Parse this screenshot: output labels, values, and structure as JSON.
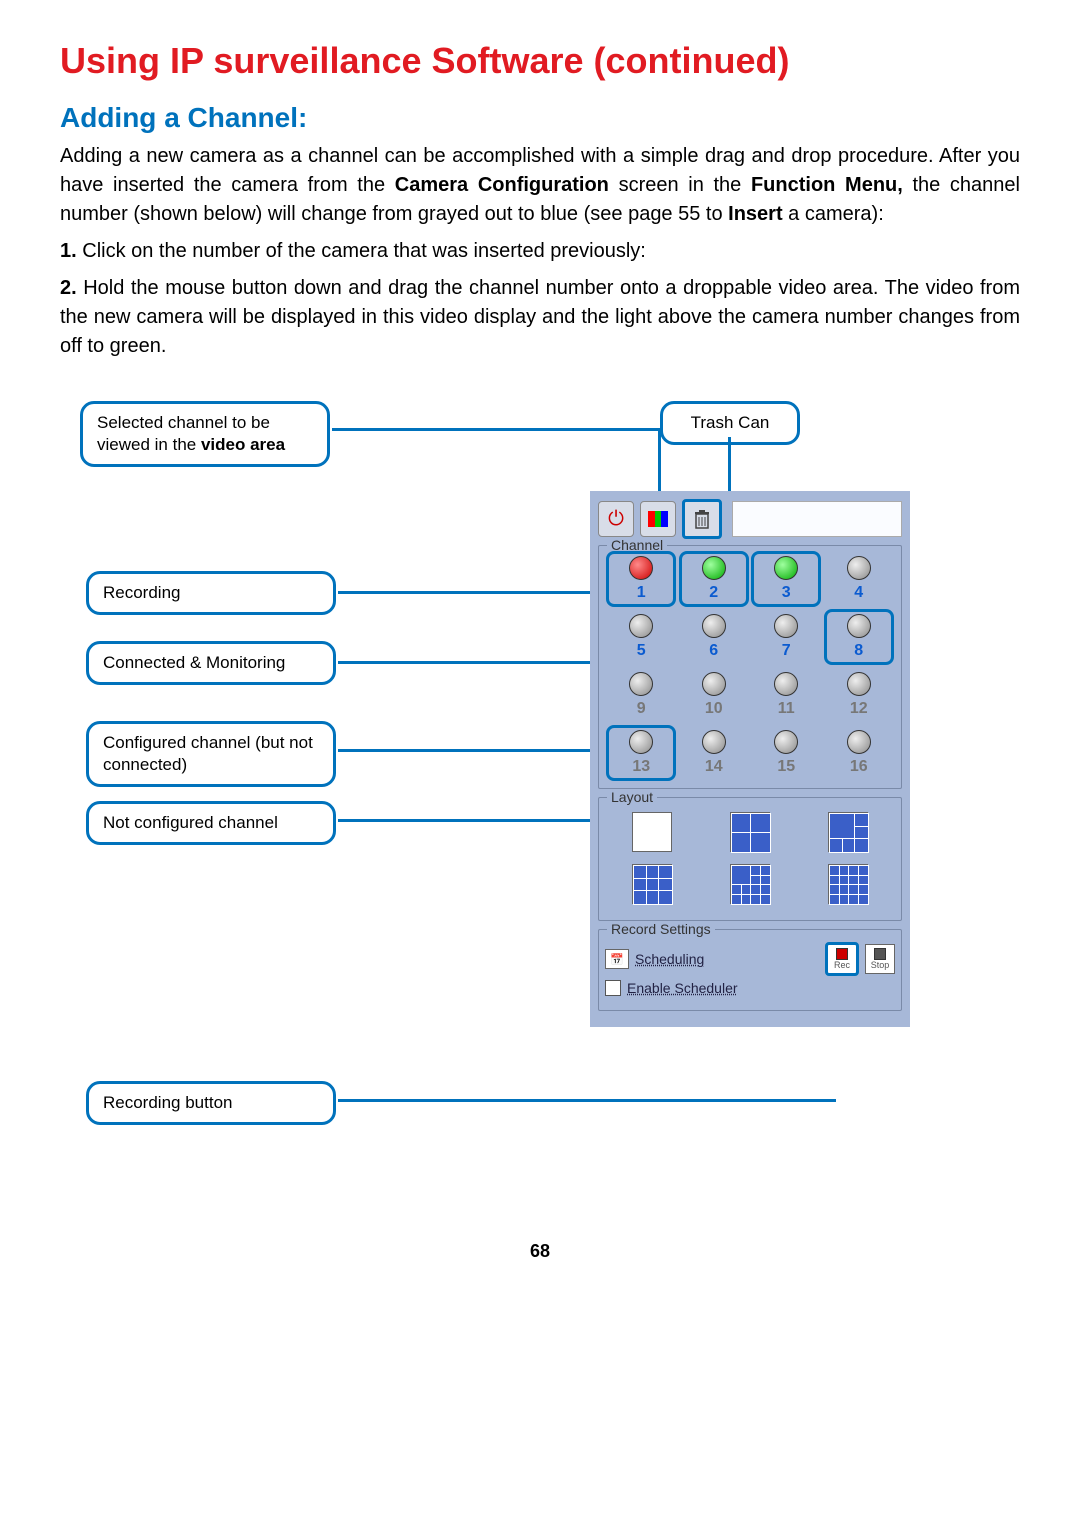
{
  "title": "Using IP surveillance Software (continued)",
  "subtitle": "Adding a Channel:",
  "intro_html": "Adding a new camera as a channel can be accomplished with a simple drag and drop procedure.  After you have inserted the camera from the <b>Camera Configuration</b> screen in the <b>Function Menu,</b> the channel number (shown below) will change from grayed out to blue (see page 55 to <b>Insert</b> a camera):",
  "step1": "1.  Click on the number of the camera that was inserted previously:",
  "step2": "2.  Hold the mouse button down and drag the channel number onto a droppable video area.  The video from the new camera will be displayed in this video display and the light above the camera number changes from off to green.",
  "callouts": {
    "selected": "Selected channel to be viewed in the <b>video area</b>",
    "trash": "Trash Can",
    "recording": "Recording",
    "connected": "Connected & Monitoring",
    "configured": "Configured channel (but not connected)",
    "notconfigured": "Not configured channel",
    "recbutton": "Recording button"
  },
  "panel": {
    "channel_label": "Channel",
    "layout_label": "Layout",
    "record_label": "Record Settings",
    "scheduling": "Scheduling",
    "enable_scheduler": "Enable Scheduler",
    "rec": "Rec",
    "stop": "Stop"
  },
  "channels": [
    {
      "n": "1",
      "led": "red",
      "blue": true,
      "hl": true
    },
    {
      "n": "2",
      "led": "green",
      "blue": true,
      "hl": true
    },
    {
      "n": "3",
      "led": "green",
      "blue": true,
      "hl": true
    },
    {
      "n": "4",
      "led": "gray",
      "blue": true,
      "hl": false
    },
    {
      "n": "5",
      "led": "gray",
      "blue": true,
      "hl": false
    },
    {
      "n": "6",
      "led": "gray",
      "blue": true,
      "hl": false
    },
    {
      "n": "7",
      "led": "gray",
      "blue": true,
      "hl": false
    },
    {
      "n": "8",
      "led": "gray",
      "blue": true,
      "hl": true
    },
    {
      "n": "9",
      "led": "gray",
      "blue": false,
      "hl": false
    },
    {
      "n": "10",
      "led": "gray",
      "blue": false,
      "hl": false
    },
    {
      "n": "11",
      "led": "gray",
      "blue": false,
      "hl": false
    },
    {
      "n": "12",
      "led": "gray",
      "blue": false,
      "hl": false
    },
    {
      "n": "13",
      "led": "gray",
      "blue": false,
      "hl": true
    },
    {
      "n": "14",
      "led": "gray",
      "blue": false,
      "hl": false
    },
    {
      "n": "15",
      "led": "gray",
      "blue": false,
      "hl": false
    },
    {
      "n": "16",
      "led": "gray",
      "blue": false,
      "hl": false
    }
  ],
  "page_number": "68"
}
